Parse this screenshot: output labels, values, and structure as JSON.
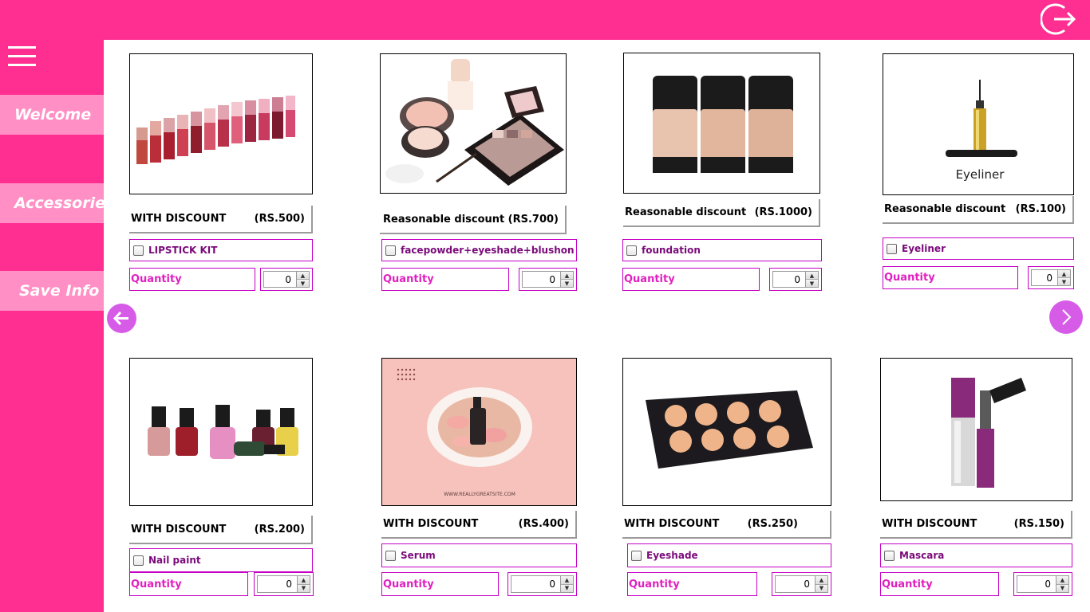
{
  "sidebar": {
    "items": [
      {
        "label": "Welcome"
      },
      {
        "label": "Accessories"
      },
      {
        "label": "Save Info"
      }
    ]
  },
  "colors": {
    "brand": "#ff2f92",
    "nav_button": "#ff8fc4",
    "arrow": "#d65ce8",
    "accent_text": "#e020c0"
  },
  "icons": {
    "logout": "logout-icon",
    "menu": "hamburger-menu-icon",
    "prev": "arrow-left-icon",
    "next": "chevron-right-icon"
  },
  "quantity_label": "Quantity",
  "products": [
    {
      "tag": "WITH DISCOUNT",
      "price": "(RS.500)",
      "name": "LIPSTICK KIT",
      "qty": "0"
    },
    {
      "tag": "Reasonable discount",
      "price": "(RS.700)",
      "name": "facepowder+eyeshade+blushon",
      "qty": "0"
    },
    {
      "tag": "Reasonable discount",
      "price": "(RS.1000)",
      "name": "foundation",
      "qty": "0"
    },
    {
      "tag": "Reasonable discount",
      "price": "(RS.100)",
      "name": "Eyeliner",
      "qty": "0",
      "image_caption": "Eyeliner"
    },
    {
      "tag": "WITH DISCOUNT",
      "price": "(RS.200)",
      "name": "Nail paint",
      "qty": "0"
    },
    {
      "tag": "WITH DISCOUNT",
      "price": "(RS.400)",
      "name": "Serum",
      "qty": "0",
      "image_caption": "WWW.REALLYGREATSITE.COM"
    },
    {
      "tag": "WITH DISCOUNT",
      "price": "(RS.250)",
      "name": "Eyeshade",
      "qty": "0"
    },
    {
      "tag": "WITH DISCOUNT",
      "price": "(RS.150)",
      "name": "Mascara",
      "qty": "0"
    }
  ]
}
